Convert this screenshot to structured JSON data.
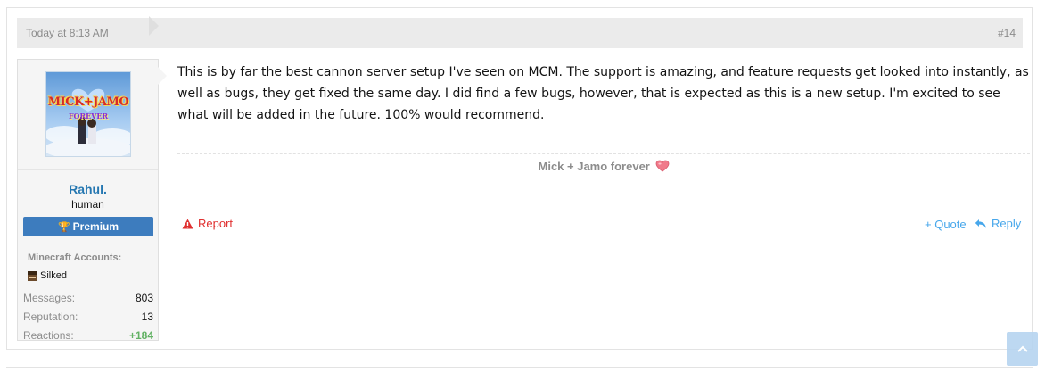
{
  "post": {
    "date": "Today at 8:13 AM",
    "number": "#14",
    "message": "This is by far the best cannon server setup I've seen on MCM. The support is amazing, and feature requests get looked into instantly, as well as bugs, they get fixed the same day. I did find a few bugs, however, that is expected as this is a new setup. I'm excited to see what will be added in the future. 100% would recommend.",
    "signature": "Mick + Jamo forever",
    "actions": {
      "report": "Report",
      "quote": "+ Quote",
      "reply": "Reply"
    }
  },
  "user": {
    "avatar_text_line1": "MICK+JAMO",
    "avatar_text_line2": "FOREVER",
    "name": "Rahul.",
    "title": "human",
    "banner": "Premium",
    "minecraft_title": "Minecraft Accounts:",
    "minecraft_account": "Silked",
    "stats": [
      {
        "key": "Messages:",
        "value": "803"
      },
      {
        "key": "Reputation:",
        "value": "13"
      },
      {
        "key": "Reactions:",
        "value": "+184"
      }
    ]
  },
  "colors": {
    "link": "#47a7eb",
    "username": "#2577b1",
    "banner": "#3d7cbe",
    "report": "#e03030",
    "positive": "#63b265"
  },
  "icons": {
    "banner": "trophy-icon",
    "report": "warning-icon",
    "reply": "reply-icon",
    "signature": "heart-icon",
    "scroll": "chevron-up-icon"
  }
}
